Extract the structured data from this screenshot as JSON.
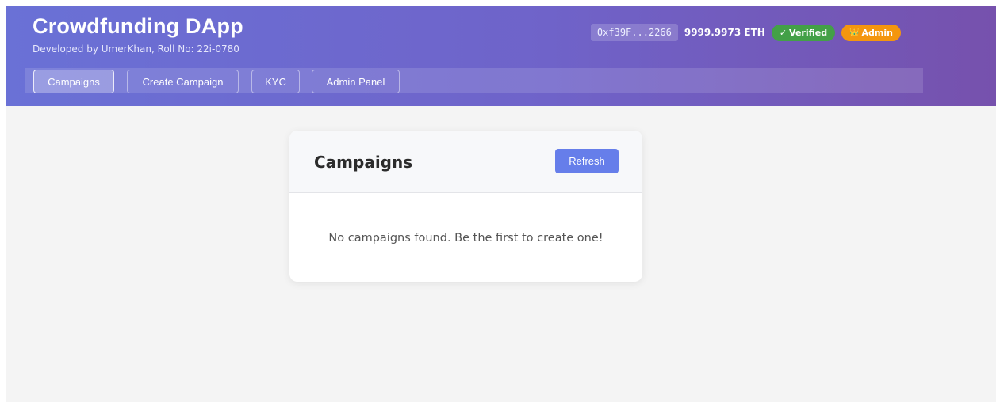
{
  "header": {
    "title": "Crowdfunding DApp",
    "subtitle": "Developed by UmerKhan, Roll No: 22i-0780",
    "account": {
      "address": "0xf39F...2266",
      "balance": "9999.9973 ETH",
      "verified_icon": "✓",
      "verified_label": "Verified",
      "admin_icon": "👑",
      "admin_label": "Admin"
    }
  },
  "nav": {
    "items": [
      {
        "label": "Campaigns",
        "active": true
      },
      {
        "label": "Create Campaign",
        "active": false
      },
      {
        "label": "KYC",
        "active": false
      },
      {
        "label": "Admin Panel",
        "active": false
      }
    ]
  },
  "campaigns": {
    "title": "Campaigns",
    "refresh_label": "Refresh",
    "empty_message": "No campaigns found. Be the first to create one!"
  },
  "colors": {
    "header_start": "#6a71d6",
    "header_end": "#7651ad",
    "verified": "#43a047",
    "admin": "#f4960e",
    "primary_button": "#667eea",
    "background": "#f4f4f4"
  }
}
